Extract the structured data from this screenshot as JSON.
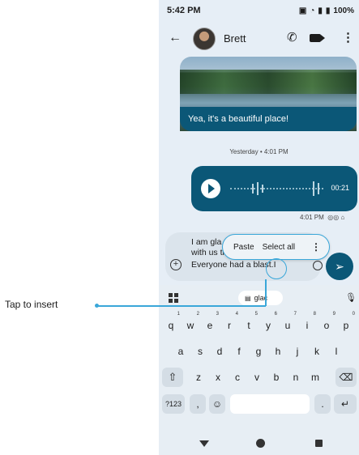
{
  "status_bar": {
    "time": "5:42 PM",
    "battery": "100%",
    "icons": [
      "nfc-icon",
      "wifi-icon",
      "signal-icon",
      "battery-icon"
    ]
  },
  "header": {
    "contact_name": "Brett",
    "icons": [
      "back-arrow-icon",
      "avatar",
      "phone-icon",
      "video-icon",
      "more-vert-icon"
    ]
  },
  "messages": {
    "image_caption": "Yea, it's a beautiful place!",
    "day_timestamp": "Yesterday • 4:01 PM",
    "voice_duration": "00:21",
    "voice_meta": "4:01 PM"
  },
  "compose": {
    "line1": "I am gla",
    "line2": "with us th",
    "line3": "Everyone had a blast.I"
  },
  "context_menu": {
    "paste": "Paste",
    "select_all": "Select all"
  },
  "keyboard": {
    "suggestion": "glac",
    "row1": [
      {
        "k": "q",
        "n": "1"
      },
      {
        "k": "w",
        "n": "2"
      },
      {
        "k": "e",
        "n": "3"
      },
      {
        "k": "r",
        "n": "4"
      },
      {
        "k": "t",
        "n": "5"
      },
      {
        "k": "y",
        "n": "6"
      },
      {
        "k": "u",
        "n": "7"
      },
      {
        "k": "i",
        "n": "8"
      },
      {
        "k": "o",
        "n": "9"
      },
      {
        "k": "p",
        "n": "0"
      }
    ],
    "row2": [
      "a",
      "s",
      "d",
      "f",
      "g",
      "h",
      "j",
      "k",
      "l"
    ],
    "row3": [
      "z",
      "x",
      "c",
      "v",
      "b",
      "n",
      "m"
    ],
    "symbols": "?123",
    "comma": ",",
    "period": "."
  },
  "annotation": {
    "label": "Tap to insert"
  },
  "colors": {
    "accent": "#0b5777",
    "highlight": "#3aa7d9",
    "background": "#e6eef6"
  }
}
